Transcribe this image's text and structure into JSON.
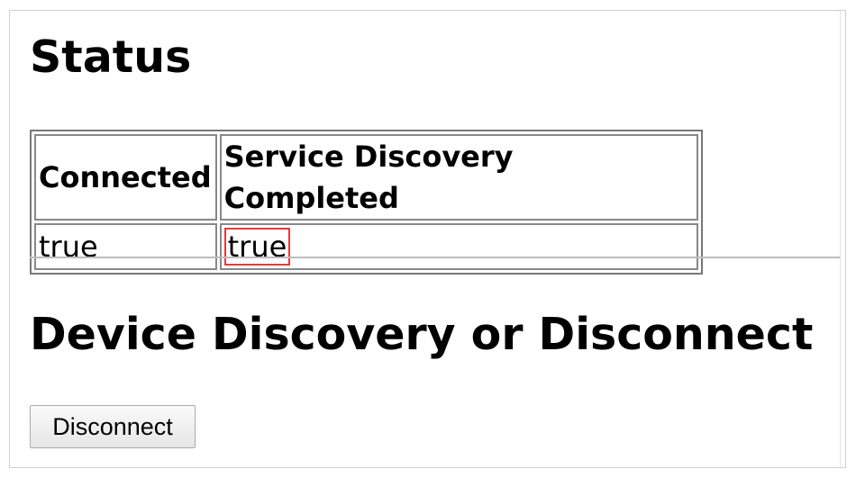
{
  "status_section": {
    "title": "Status",
    "table": {
      "headers": [
        "Connected",
        "Service Discovery Completed"
      ],
      "rows": [
        [
          "true",
          "true"
        ]
      ]
    }
  },
  "device_section": {
    "title": "Device Discovery or Disconnect",
    "disconnect_label": "Disconnect"
  },
  "colors": {
    "highlight": "#e23b3b",
    "border": "#888888"
  }
}
